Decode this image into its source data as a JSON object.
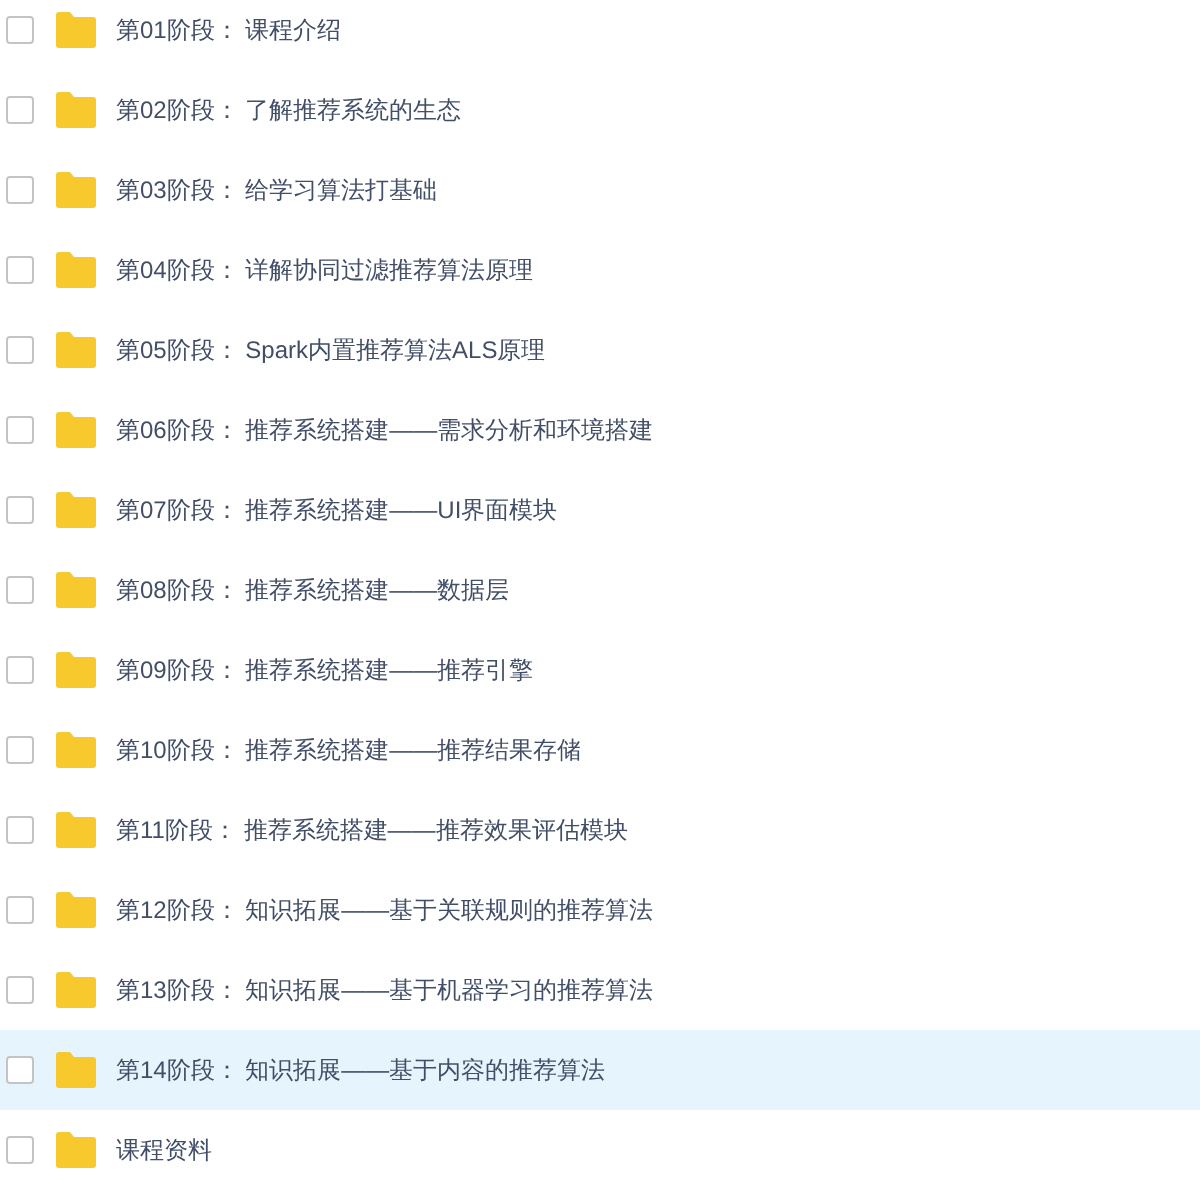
{
  "files": [
    {
      "name": "第01阶段： 课程介绍",
      "checked": false,
      "selected": false
    },
    {
      "name": "第02阶段： 了解推荐系统的生态",
      "checked": false,
      "selected": false
    },
    {
      "name": "第03阶段： 给学习算法打基础",
      "checked": false,
      "selected": false
    },
    {
      "name": "第04阶段： 详解协同过滤推荐算法原理",
      "checked": false,
      "selected": false
    },
    {
      "name": "第05阶段： Spark内置推荐算法ALS原理",
      "checked": false,
      "selected": false
    },
    {
      "name": "第06阶段： 推荐系统搭建——需求分析和环境搭建",
      "checked": false,
      "selected": false
    },
    {
      "name": "第07阶段： 推荐系统搭建——UI界面模块",
      "checked": false,
      "selected": false
    },
    {
      "name": "第08阶段： 推荐系统搭建——数据层",
      "checked": false,
      "selected": false
    },
    {
      "name": "第09阶段： 推荐系统搭建——推荐引擎",
      "checked": false,
      "selected": false
    },
    {
      "name": "第10阶段： 推荐系统搭建——推荐结果存储",
      "checked": false,
      "selected": false
    },
    {
      "name": "第11阶段： 推荐系统搭建——推荐效果评估模块",
      "checked": false,
      "selected": false
    },
    {
      "name": "第12阶段： 知识拓展——基于关联规则的推荐算法",
      "checked": false,
      "selected": false
    },
    {
      "name": "第13阶段： 知识拓展——基于机器学习的推荐算法",
      "checked": false,
      "selected": false
    },
    {
      "name": "第14阶段： 知识拓展——基于内容的推荐算法",
      "checked": false,
      "selected": true
    },
    {
      "name": "课程资料",
      "checked": false,
      "selected": false
    }
  ]
}
